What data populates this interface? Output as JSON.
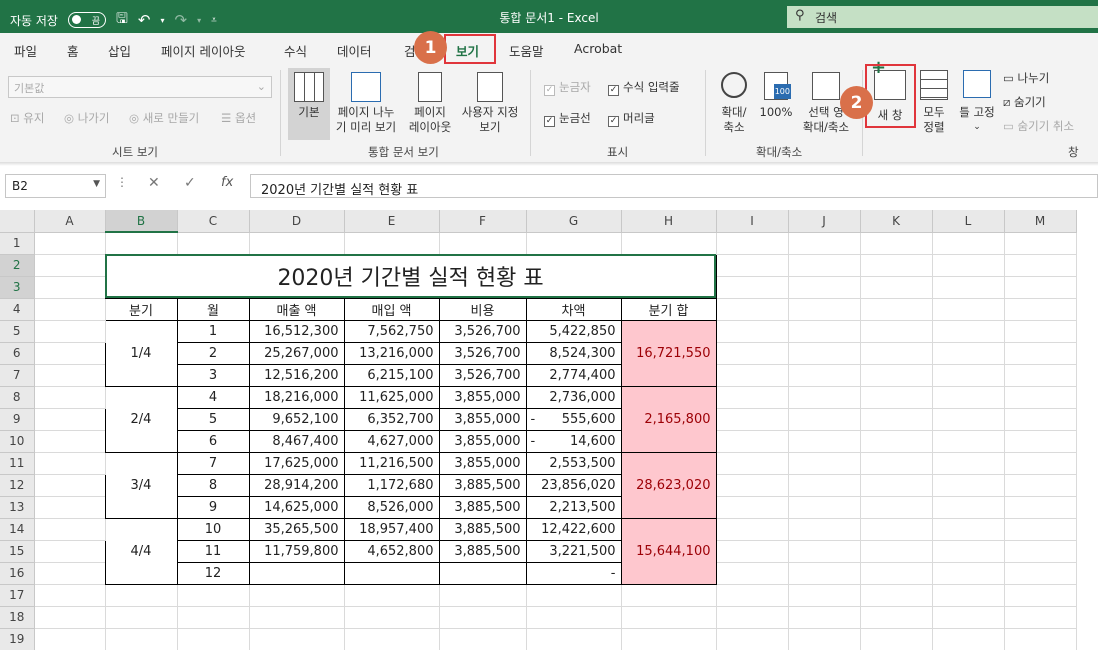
{
  "titlebar": {
    "autosave_label": "자동 저장",
    "autosave_state": "끔",
    "doc_title": "통합 문서1  -  Excel",
    "search_placeholder": "검색"
  },
  "tabs": [
    "파일",
    "홈",
    "삽입",
    "페이지 레이아웃",
    "수식",
    "데이터",
    "검",
    "보기",
    "도움말",
    "Acrobat"
  ],
  "active_tab": "보기",
  "ribbon": {
    "sheet_view": {
      "dropdown_value": "기본값",
      "keep": "유지",
      "exit": "나가기",
      "new": "새로 만들기",
      "options": "옵션",
      "label": "시트 보기"
    },
    "workbook_views": {
      "normal": "기본",
      "page_break_1": "페이지 나누",
      "page_break_2": "기 미리 보기",
      "page_layout_1": "페이지",
      "page_layout_2": "레이아웃",
      "custom_1": "사용자 지정",
      "custom_2": "보기",
      "label": "통합 문서 보기"
    },
    "show": {
      "ruler": "눈금자",
      "formula_bar": "수식 입력줄",
      "gridlines": "눈금선",
      "headings": "머리글",
      "label": "표시"
    },
    "zoom": {
      "zoom_1": "확대/",
      "zoom_2": "축소",
      "hundred": "100%",
      "sel_1": "선택 영",
      "sel_2": "확대/축소",
      "label": "확대/축소"
    },
    "window": {
      "new_window": "새 창",
      "arrange_1": "모두",
      "arrange_2": "정렬",
      "freeze": "틀 고정",
      "split": "나누기",
      "hide": "숨기기",
      "unhide": "숨기기 취소",
      "label": "창"
    }
  },
  "formula_bar": {
    "name_box": "B2",
    "fx": "fx",
    "content": "2020년 기간별 실적 현황 표"
  },
  "columns": [
    "A",
    "B",
    "C",
    "D",
    "E",
    "F",
    "G",
    "H",
    "I",
    "J",
    "K",
    "L",
    "M"
  ],
  "rows": [
    "1",
    "2",
    "3",
    "4",
    "5",
    "6",
    "7",
    "8",
    "9",
    "10",
    "11",
    "12",
    "13",
    "14",
    "15",
    "16",
    "17",
    "18",
    "19"
  ],
  "sheet": {
    "title": "2020년 기간별 실적 현황 표",
    "headers": [
      "분기",
      "월",
      "매출 액",
      "매입 액",
      "비용",
      "차액",
      "분기 합"
    ],
    "quarters": [
      {
        "label": "1/4",
        "sum": "16,721,550",
        "months": [
          {
            "m": "1",
            "sales": "16,512,300",
            "purchase": "7,562,750",
            "cost": "3,526,700",
            "dash": "",
            "diff": "5,422,850"
          },
          {
            "m": "2",
            "sales": "25,267,000",
            "purchase": "13,216,000",
            "cost": "3,526,700",
            "dash": "",
            "diff": "8,524,300"
          },
          {
            "m": "3",
            "sales": "12,516,200",
            "purchase": "6,215,100",
            "cost": "3,526,700",
            "dash": "",
            "diff": "2,774,400"
          }
        ]
      },
      {
        "label": "2/4",
        "sum": "2,165,800",
        "months": [
          {
            "m": "4",
            "sales": "18,216,000",
            "purchase": "11,625,000",
            "cost": "3,855,000",
            "dash": "",
            "diff": "2,736,000"
          },
          {
            "m": "5",
            "sales": "9,652,100",
            "purchase": "6,352,700",
            "cost": "3,855,000",
            "dash": "-",
            "diff": "555,600"
          },
          {
            "m": "6",
            "sales": "8,467,400",
            "purchase": "4,627,000",
            "cost": "3,855,000",
            "dash": "-",
            "diff": "14,600"
          }
        ]
      },
      {
        "label": "3/4",
        "sum": "28,623,020",
        "months": [
          {
            "m": "7",
            "sales": "17,625,000",
            "purchase": "11,216,500",
            "cost": "3,855,000",
            "dash": "",
            "diff": "2,553,500"
          },
          {
            "m": "8",
            "sales": "28,914,200",
            "purchase": "1,172,680",
            "cost": "3,885,500",
            "dash": "",
            "diff": "23,856,020"
          },
          {
            "m": "9",
            "sales": "14,625,000",
            "purchase": "8,526,000",
            "cost": "3,885,500",
            "dash": "",
            "diff": "2,213,500"
          }
        ]
      },
      {
        "label": "4/4",
        "sum": "15,644,100",
        "months": [
          {
            "m": "10",
            "sales": "35,265,500",
            "purchase": "18,957,400",
            "cost": "3,885,500",
            "dash": "",
            "diff": "12,422,600"
          },
          {
            "m": "11",
            "sales": "11,759,800",
            "purchase": "4,652,800",
            "cost": "3,885,500",
            "dash": "",
            "diff": "3,221,500"
          },
          {
            "m": "12",
            "sales": "",
            "purchase": "",
            "cost": "",
            "dash": "",
            "diff": "-"
          }
        ]
      }
    ]
  },
  "callouts": [
    "1",
    "2"
  ],
  "colors": {
    "excel_green": "#217346",
    "pink_fill": "#fec7ce",
    "pink_text": "#9c0006",
    "callout": "#d9704a",
    "highlight": "#e0353b"
  }
}
